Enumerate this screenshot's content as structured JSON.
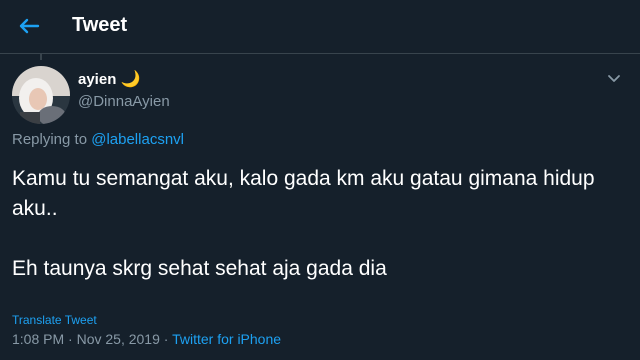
{
  "header": {
    "back_icon": "arrow-left-icon",
    "title": "Tweet"
  },
  "tweet": {
    "author": {
      "display_name": "ayien",
      "emoji": "🌙",
      "handle": "@DinnaAyien"
    },
    "replying_to_prefix": "Replying to ",
    "replying_to_handle": "@labellacsnvl",
    "text_lines": [
      "Kamu tu semangat aku, kalo gada km aku gatau gimana hidup aku..",
      "Eh taunya skrg sehat sehat aja gada dia"
    ],
    "translate_label": "Translate Tweet",
    "time": "1:08 PM",
    "date": "Nov 25, 2019",
    "separator": " · ",
    "source": "Twitter for iPhone"
  },
  "colors": {
    "background": "#15202b",
    "accent": "#1da1f2",
    "secondary_text": "#8899a6",
    "border": "#38444d"
  }
}
